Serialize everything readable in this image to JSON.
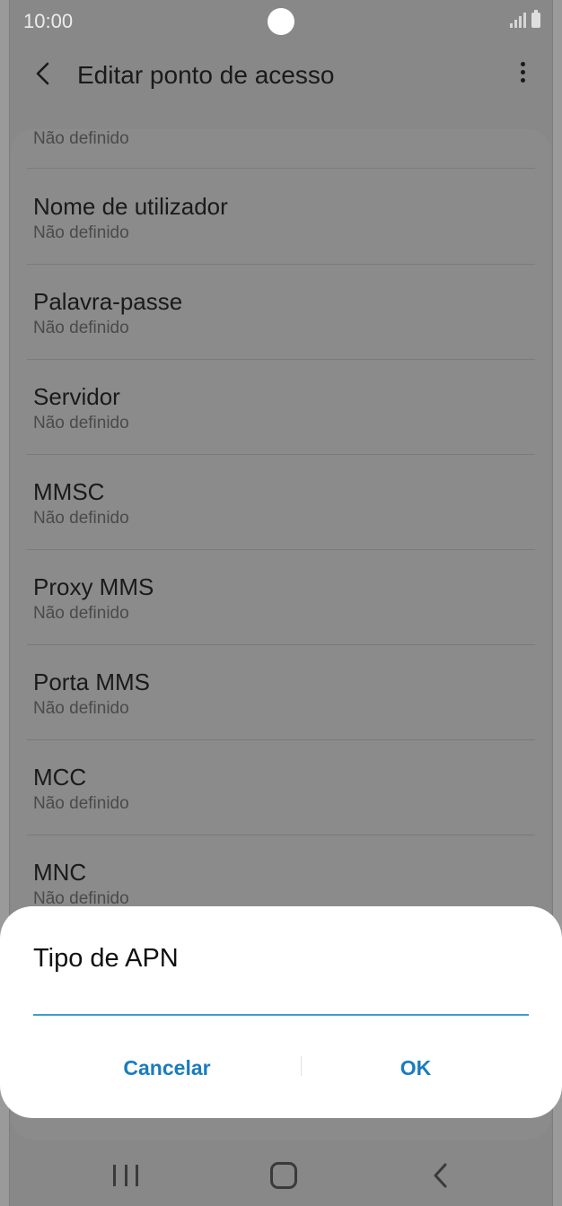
{
  "status_bar": {
    "time": "10:00"
  },
  "app_bar": {
    "title": "Editar ponto de acesso",
    "back_icon": "chevron-left-icon",
    "more_icon": "more-vert-icon"
  },
  "settings": {
    "partial_top_value": "Não definido",
    "items": [
      {
        "title": "Nome de utilizador",
        "value": "Não definido"
      },
      {
        "title": "Palavra-passe",
        "value": "Não definido"
      },
      {
        "title": "Servidor",
        "value": "Não definido"
      },
      {
        "title": "MMSC",
        "value": "Não definido"
      },
      {
        "title": "Proxy MMS",
        "value": "Não definido"
      },
      {
        "title": "Porta MMS",
        "value": "Não definido"
      },
      {
        "title": "MCC",
        "value": "Não definido"
      },
      {
        "title": "MNC",
        "value": "Não definido"
      }
    ]
  },
  "dialog": {
    "title": "Tipo de APN",
    "input_value": "",
    "cancel_label": "Cancelar",
    "ok_label": "OK",
    "accent_color": "#1a7cbf",
    "underline_color": "#3a9fd0"
  },
  "nav_bar": {
    "recent_icon": "recent-apps-icon",
    "home_icon": "home-icon",
    "back_icon": "back-icon"
  }
}
